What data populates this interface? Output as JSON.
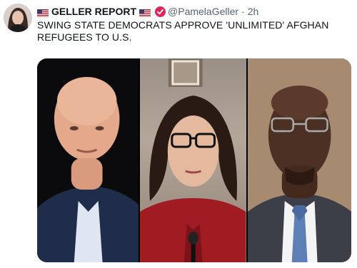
{
  "tweet": {
    "display_name": "GELLER REPORT",
    "handle": "@PamelaGeller",
    "separator": "·",
    "time": "2h",
    "text": "SWING STATE DEMOCRATS APPROVE 'UNLIMITED' AFGHAN REFUGEES TO U.S."
  },
  "icons": {
    "left_flag": "us-flag-icon",
    "right_flag": "us-flag-icon",
    "verified": "verified-badge-icon"
  },
  "colors": {
    "verified": "#e0245e",
    "handle": "#536471",
    "text": "#0f1419"
  }
}
